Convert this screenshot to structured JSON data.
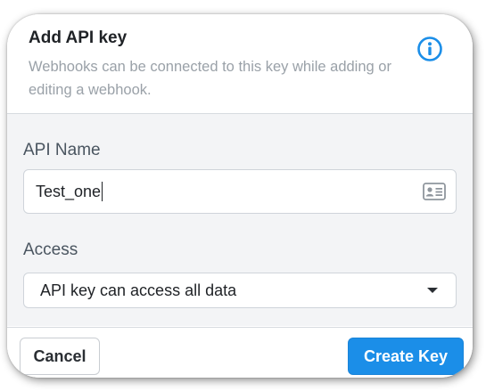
{
  "dialog": {
    "title": "Add API key",
    "subtitle": "Webhooks can be connected to this key while adding or editing a webhook.",
    "info_icon": "info-circle-icon"
  },
  "form": {
    "name_label": "API Name",
    "name_value": "Test_one",
    "name_field_icon": "contact-card-icon",
    "access_label": "Access",
    "access_selected": "API key can access all data"
  },
  "footer": {
    "cancel_label": "Cancel",
    "create_label": "Create Key"
  },
  "colors": {
    "accent": "#1b8ee8",
    "body_background": "#f3f4f6",
    "label_text": "#4a5560",
    "subtitle_text": "#9aa1a8"
  }
}
